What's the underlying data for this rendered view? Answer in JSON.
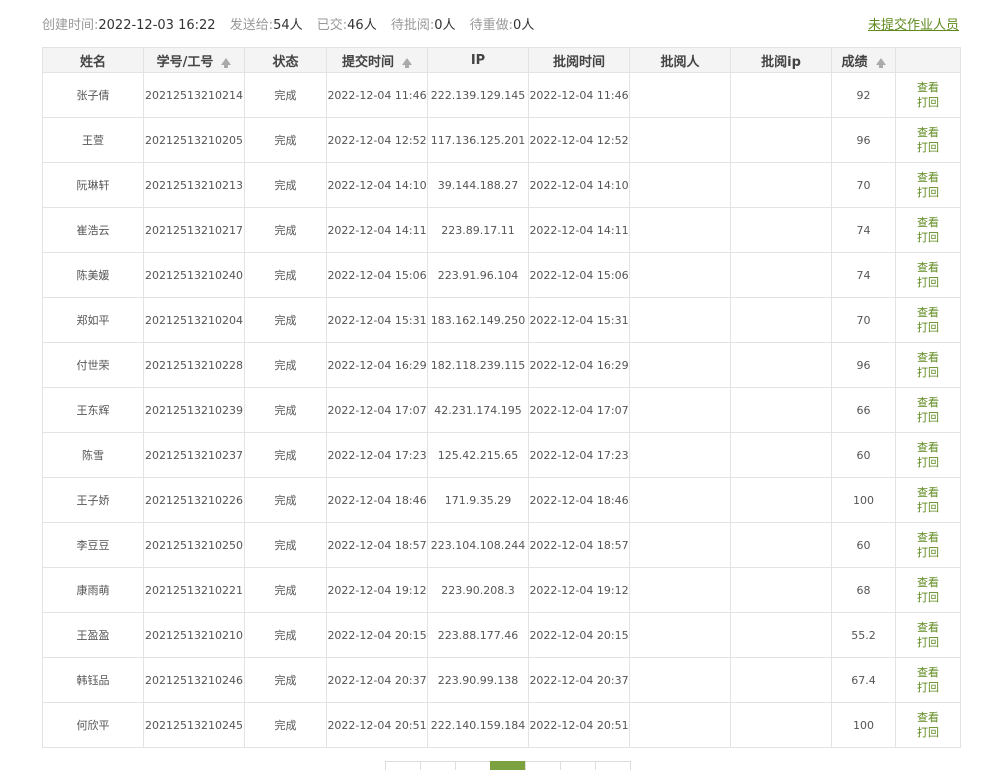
{
  "summary": {
    "created_label": "创建时间:",
    "created_value": "2022-12-03 16:22",
    "sent_label": "发送给:",
    "sent_value": "54人",
    "submitted_label": "已交:",
    "submitted_value": "46人",
    "pending_label": "待批阅:",
    "pending_value": "0人",
    "redo_label": "待重做:",
    "redo_value": "0人"
  },
  "unsubmitted_link": "未提交作业人员",
  "columns": {
    "name": "姓名",
    "id": "学号/工号",
    "status": "状态",
    "submit_time": "提交时间",
    "ip": "IP",
    "review_time": "批阅时间",
    "reviewer": "批阅人",
    "reviewer_ip": "批阅ip",
    "score": "成绩",
    "actions": ""
  },
  "actions": {
    "view": "查看",
    "return": "打回"
  },
  "rows": [
    {
      "name": "张子倩",
      "id": "20212513210214",
      "status": "完成",
      "submit_time": "2022-12-04 11:46",
      "ip": "222.139.129.145",
      "review_time": "2022-12-04 11:46",
      "reviewer": "",
      "reviewer_ip": "",
      "score": "92"
    },
    {
      "name": "王萱",
      "id": "20212513210205",
      "status": "完成",
      "submit_time": "2022-12-04 12:52",
      "ip": "117.136.125.201",
      "review_time": "2022-12-04 12:52",
      "reviewer": "",
      "reviewer_ip": "",
      "score": "96"
    },
    {
      "name": "阮琳轩",
      "id": "20212513210213",
      "status": "完成",
      "submit_time": "2022-12-04 14:10",
      "ip": "39.144.188.27",
      "review_time": "2022-12-04 14:10",
      "reviewer": "",
      "reviewer_ip": "",
      "score": "70"
    },
    {
      "name": "崔浩云",
      "id": "20212513210217",
      "status": "完成",
      "submit_time": "2022-12-04 14:11",
      "ip": "223.89.17.11",
      "review_time": "2022-12-04 14:11",
      "reviewer": "",
      "reviewer_ip": "",
      "score": "74"
    },
    {
      "name": "陈美媛",
      "id": "20212513210240",
      "status": "完成",
      "submit_time": "2022-12-04 15:06",
      "ip": "223.91.96.104",
      "review_time": "2022-12-04 15:06",
      "reviewer": "",
      "reviewer_ip": "",
      "score": "74"
    },
    {
      "name": "郑如平",
      "id": "20212513210204",
      "status": "完成",
      "submit_time": "2022-12-04 15:31",
      "ip": "183.162.149.250",
      "review_time": "2022-12-04 15:31",
      "reviewer": "",
      "reviewer_ip": "",
      "score": "70"
    },
    {
      "name": "付世荣",
      "id": "20212513210228",
      "status": "完成",
      "submit_time": "2022-12-04 16:29",
      "ip": "182.118.239.115",
      "review_time": "2022-12-04 16:29",
      "reviewer": "",
      "reviewer_ip": "",
      "score": "96"
    },
    {
      "name": "王东辉",
      "id": "20212513210239",
      "status": "完成",
      "submit_time": "2022-12-04 17:07",
      "ip": "42.231.174.195",
      "review_time": "2022-12-04 17:07",
      "reviewer": "",
      "reviewer_ip": "",
      "score": "66"
    },
    {
      "name": "陈雪",
      "id": "20212513210237",
      "status": "完成",
      "submit_time": "2022-12-04 17:23",
      "ip": "125.42.215.65",
      "review_time": "2022-12-04 17:23",
      "reviewer": "",
      "reviewer_ip": "",
      "score": "60"
    },
    {
      "name": "王子娇",
      "id": "20212513210226",
      "status": "完成",
      "submit_time": "2022-12-04 18:46",
      "ip": "171.9.35.29",
      "review_time": "2022-12-04 18:46",
      "reviewer": "",
      "reviewer_ip": "",
      "score": "100"
    },
    {
      "name": "李豆豆",
      "id": "20212513210250",
      "status": "完成",
      "submit_time": "2022-12-04 18:57",
      "ip": "223.104.108.244",
      "review_time": "2022-12-04 18:57",
      "reviewer": "",
      "reviewer_ip": "",
      "score": "60"
    },
    {
      "name": "康雨萌",
      "id": "20212513210221",
      "status": "完成",
      "submit_time": "2022-12-04 19:12",
      "ip": "223.90.208.3",
      "review_time": "2022-12-04 19:12",
      "reviewer": "",
      "reviewer_ip": "",
      "score": "68"
    },
    {
      "name": "王盈盈",
      "id": "20212513210210",
      "status": "完成",
      "submit_time": "2022-12-04 20:15",
      "ip": "223.88.177.46",
      "review_time": "2022-12-04 20:15",
      "reviewer": "",
      "reviewer_ip": "",
      "score": "55.2"
    },
    {
      "name": "韩钰品",
      "id": "20212513210246",
      "status": "完成",
      "submit_time": "2022-12-04 20:37",
      "ip": "223.90.99.138",
      "review_time": "2022-12-04 20:37",
      "reviewer": "",
      "reviewer_ip": "",
      "score": "67.4"
    },
    {
      "name": "何欣平",
      "id": "20212513210245",
      "status": "完成",
      "submit_time": "2022-12-04 20:51",
      "ip": "222.140.159.184",
      "review_time": "2022-12-04 20:51",
      "reviewer": "",
      "reviewer_ip": "",
      "score": "100"
    }
  ],
  "colors": {
    "accent": "#5f8a1f",
    "active_page": "#7ba23f",
    "header_bg": "#f4f4f4",
    "border": "#e3e3e3"
  }
}
